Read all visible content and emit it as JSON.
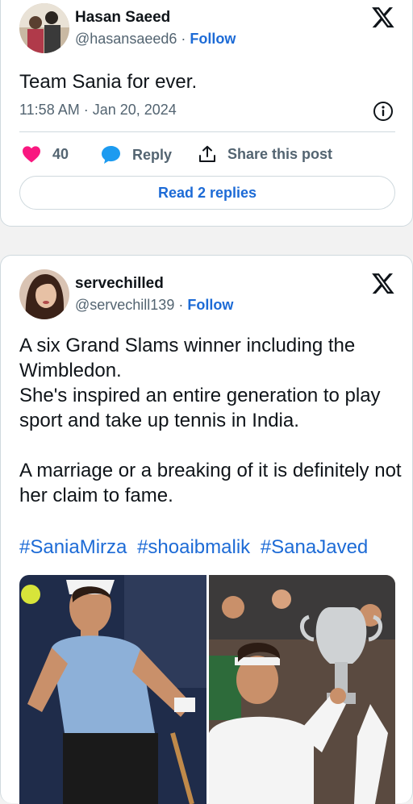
{
  "tweet1": {
    "author_name": "Hasan Saeed",
    "handle": "@hasansaeed6",
    "separator": "·",
    "follow_label": "Follow",
    "text": "Team Sania for ever.",
    "timestamp": "11:58 AM · Jan 20, 2024",
    "like_count": "40",
    "reply_label": "Reply",
    "share_label": "Share this post",
    "read_replies_label": "Read 2 replies"
  },
  "tweet2": {
    "author_name": "servechilled",
    "handle": "@servechill139",
    "separator": "·",
    "follow_label": "Follow",
    "text": "A six Grand Slams winner including the Wimbledon.\nShe's inspired an entire generation to play sport and take up tennis in India.\n\nA marriage or a breaking of it is definitely not her claim to fame.",
    "hashtags": [
      "#SaniaMirza",
      "#shoaibmalik",
      "#SanaJaved"
    ]
  },
  "colors": {
    "link_blue": "#1d6bd6",
    "like_pink": "#f91880",
    "text_dark": "#0f1419",
    "text_grey": "#536471",
    "border": "#cfd9de"
  },
  "icons": [
    "x-logo-icon",
    "info-icon",
    "heart-icon",
    "reply-bubble-icon",
    "share-icon"
  ]
}
